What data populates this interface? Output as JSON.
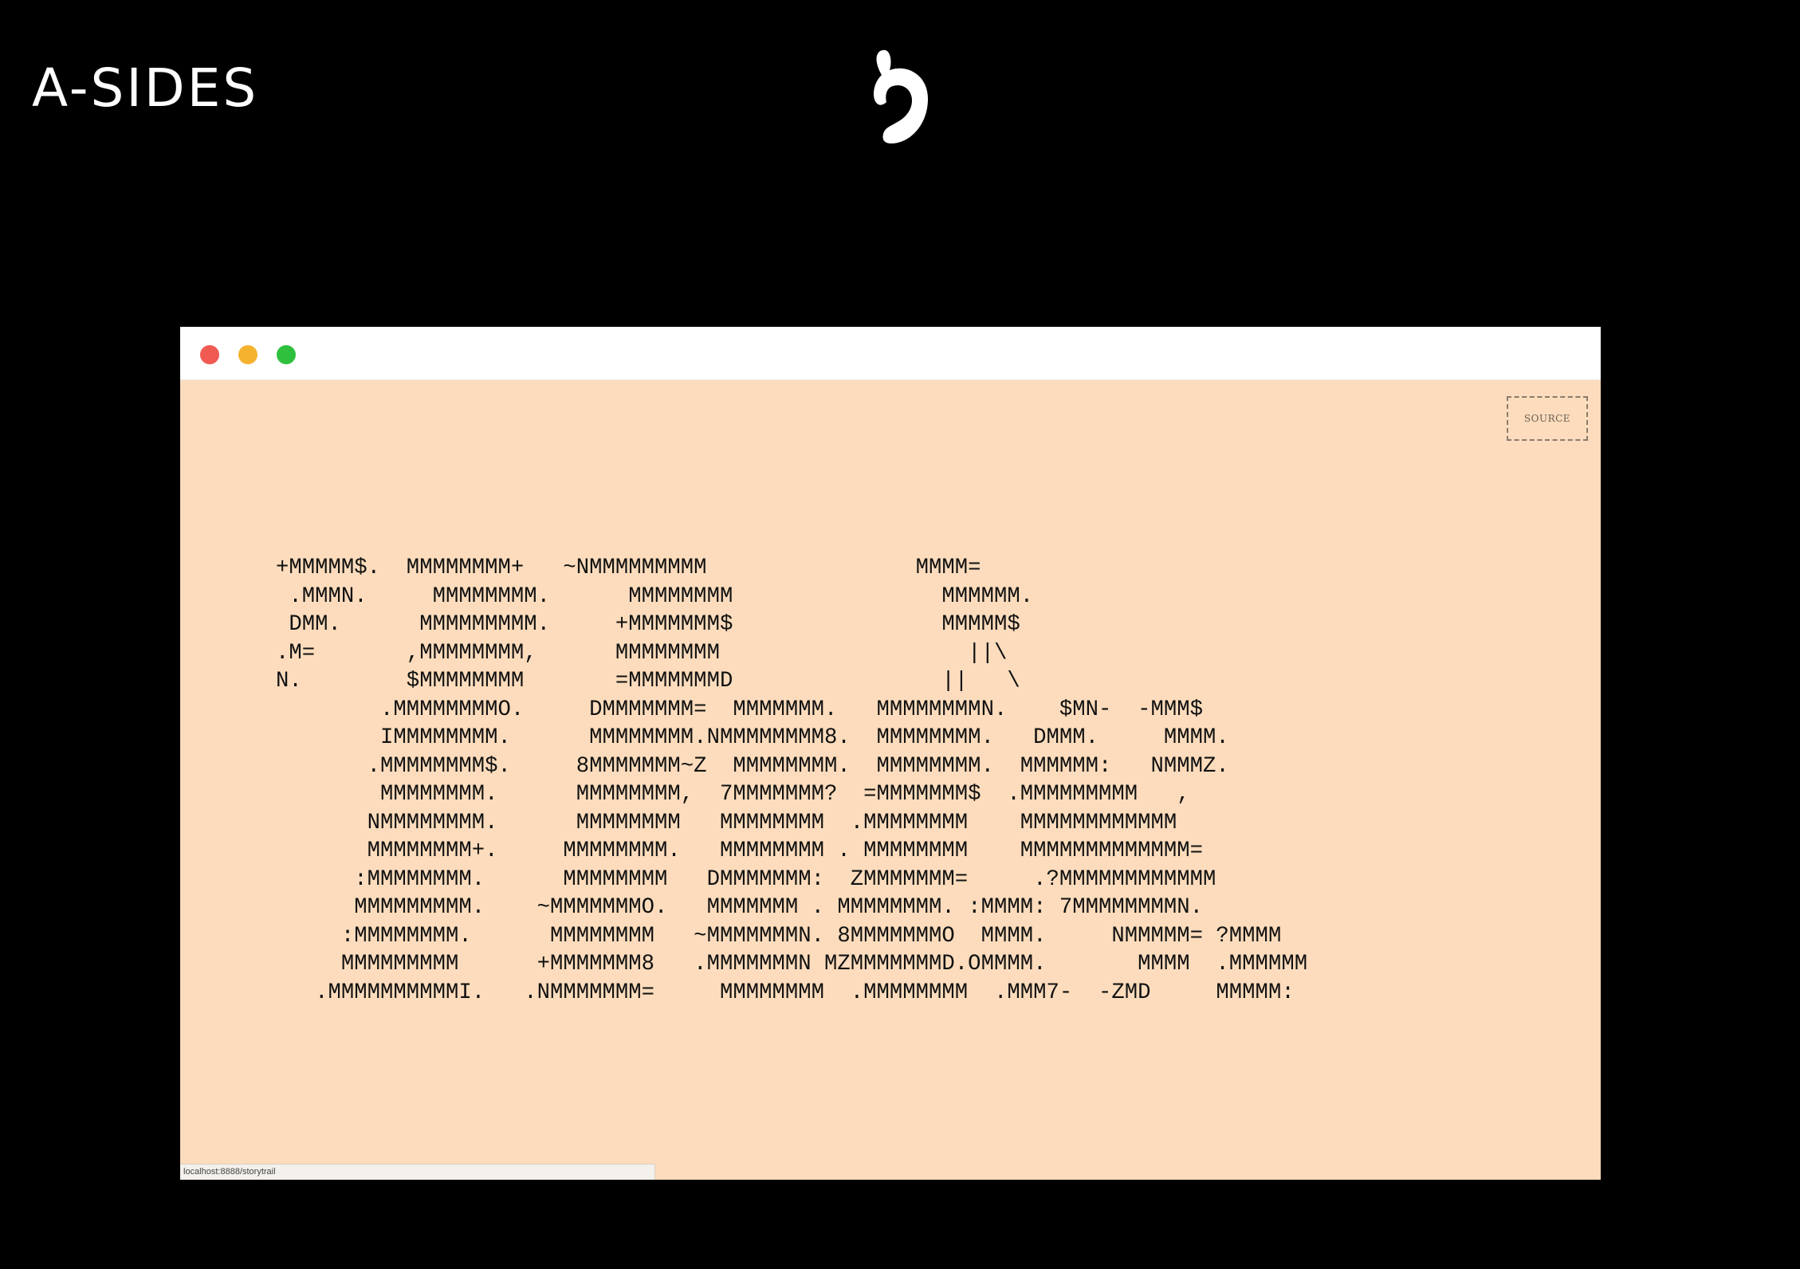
{
  "brand": {
    "title": "A-SIDES"
  },
  "logo": {
    "icon": "stylized-b-logo-icon",
    "color": "#ffffff"
  },
  "window": {
    "traffic_lights": {
      "close": "#f05a52",
      "minimize": "#f4b22e",
      "maximize": "#2fc13e"
    },
    "background": "#fcdcbc",
    "source_button": {
      "label": "SOURCE"
    },
    "ascii_art": "+MMMMM$.  MMMMMMMM+   ~NMMMMMMMMM                MMMM=\n .MMMN.     MMMMMMMM.      MMMMMMMM                MMMMMM.\n DMM.      MMMMMMMMM.     +MMMMMMM$                MMMMM$\n.M=       ,MMMMMMMM,      MMMMMMMM                   ||\\\nN.        $MMMMMMMM       =MMMMMMMD                ||   \\\n        .MMMMMMMMO.     DMMMMMMM=  MMMMMMM.   MMMMMMMMN.    $MN-  -MMM$\n        IMMMMMMMM.      MMMMMMMM.NMMMMMMMM8.  MMMMMMMM.   DMMM.     MMMM.\n       .MMMMMMMM$.     8MMMMMMM~Z  MMMMMMMM.  MMMMMMMM.  MMMMMM:   NMMMZ.\n        MMMMMMMM.      MMMMMMMM,  7MMMMMMM?  =MMMMMMM$  .MMMMMMMMM   ,\n       NMMMMMMMM.      MMMMMMMM   MMMMMMMM  .MMMMMMMM    MMMMMMMMMMMM\n       MMMMMMMM+.     MMMMMMMM.   MMMMMMMM . MMMMMMMM    MMMMMMMMMMMMM=\n      :MMMMMMMM.      MMMMMMMM   DMMMMMMM:  ZMMMMMMM=     .?MMMMMMMMMMMM\n      MMMMMMMMM.    ~MMMMMMMO.   MMMMMMM . MMMMMMMM. :MMMM: 7MMMMMMMMN.\n     :MMMMMMMM.      MMMMMMMM   ~MMMMMMMN. 8MMMMMMMO  MMMM.     NMMMMM= ?MMMM\n     MMMMMMMMM      +MMMMMMM8   .MMMMMMMN MZMMMMMMMD.OMMMM.       MMMM  .MMMMMM\n   .MMMMMMMMMMI.   .NMMMMMMM=     MMMMMMMM  .MMMMMMMM  .MMM7-  -ZMD     MMMMM:",
    "status_url": "localhost:8888/storytrail"
  }
}
